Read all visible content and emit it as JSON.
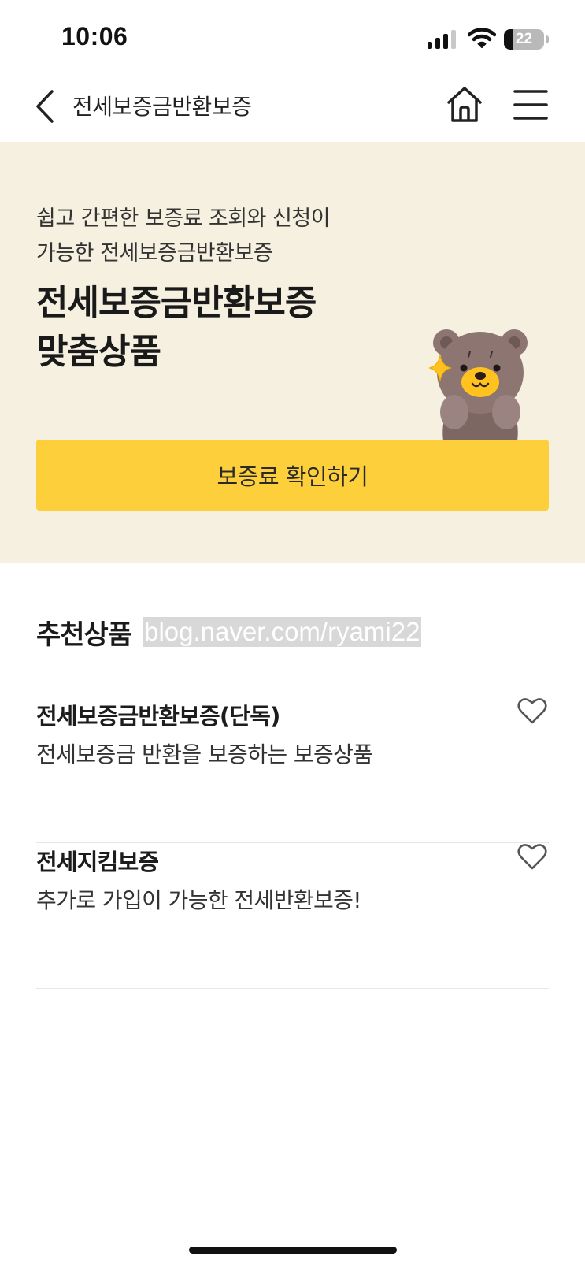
{
  "status_bar": {
    "time": "10:06",
    "battery_percent": "22",
    "icons": [
      "signal-icon",
      "wifi-icon",
      "battery-icon"
    ]
  },
  "nav": {
    "title": "전세보증금반환보증",
    "back_icon": "chevron-left-icon",
    "home_icon": "home-icon",
    "menu_icon": "hamburger-menu-icon"
  },
  "hero": {
    "subtitle_lines": [
      "쉽고 간편한 보증료 조회와 신청이",
      "가능한 전세보증금반환보증"
    ],
    "title_lines": [
      "전세보증금반환보증",
      "맞춤상품"
    ],
    "cta_label": "보증료 확인하기",
    "mascot": "bear-mascot-icon",
    "background_color": "#f5f0df",
    "cta_color": "#fdd03b"
  },
  "recommended": {
    "title": "추천상품",
    "watermark": "blog.naver.com/ryami22",
    "products": [
      {
        "name": "전세보증금반환보증(단독)",
        "description": "전세보증금 반환을 보증하는 보증상품",
        "favorite_icon": "heart-outline-icon"
      },
      {
        "name": "전세지킴보증",
        "description": "추가로 가입이 가능한 전세반환보증!",
        "favorite_icon": "heart-outline-icon"
      }
    ]
  }
}
